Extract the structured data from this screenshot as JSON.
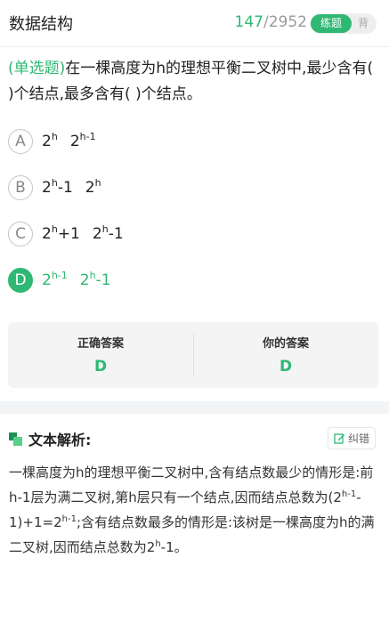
{
  "header": {
    "title": "数据结构",
    "current": "147",
    "separator": "/",
    "total": "2952",
    "mode_active": "练题",
    "mode_inactive": "背"
  },
  "question": {
    "type": "(单选题)",
    "text": "在一棵高度为h的理想平衡二叉树中,最少含有(        )个结点,最多含有(        )个结点。"
  },
  "options": [
    {
      "letter": "A",
      "part1": "2",
      "sup1": "h",
      "part2": "2",
      "sup2": "h-1",
      "tail": ""
    },
    {
      "letter": "B",
      "part1": "2",
      "sup1": "h",
      "tail1": "-1",
      "part2": "2",
      "sup2": "h",
      "tail": ""
    },
    {
      "letter": "C",
      "part1": "2",
      "sup1": "h",
      "tail1": "+1",
      "part2": "2",
      "sup2": "h",
      "tail": "-1"
    },
    {
      "letter": "D",
      "part1": "2",
      "sup1": "h-1",
      "tail1": "",
      "part2": "2",
      "sup2": "h",
      "tail": "-1"
    }
  ],
  "selected": "D",
  "answers": {
    "correct_label": "正确答案",
    "correct_value": "D",
    "yours_label": "你的答案",
    "yours_value": "D"
  },
  "explanation": {
    "title": "文本解析:",
    "fix_label": "纠错",
    "t1": "一棵高度为h的理想平衡二叉树中,含有结点数最少的情形是:前h-1层为满二叉树,第h层只有一个结点,因而结点总数为(2",
    "s1": "h-1",
    "t2": "-1)+1=2",
    "s2": "h-1",
    "t3": ";含有结点数最多的情形是:该树是一棵高度为h的满二叉树,因而结点总数为2",
    "s3": "h",
    "t4": "-1。"
  },
  "colors": {
    "accent": "#2fb873",
    "muted": "#9a9a9a"
  }
}
